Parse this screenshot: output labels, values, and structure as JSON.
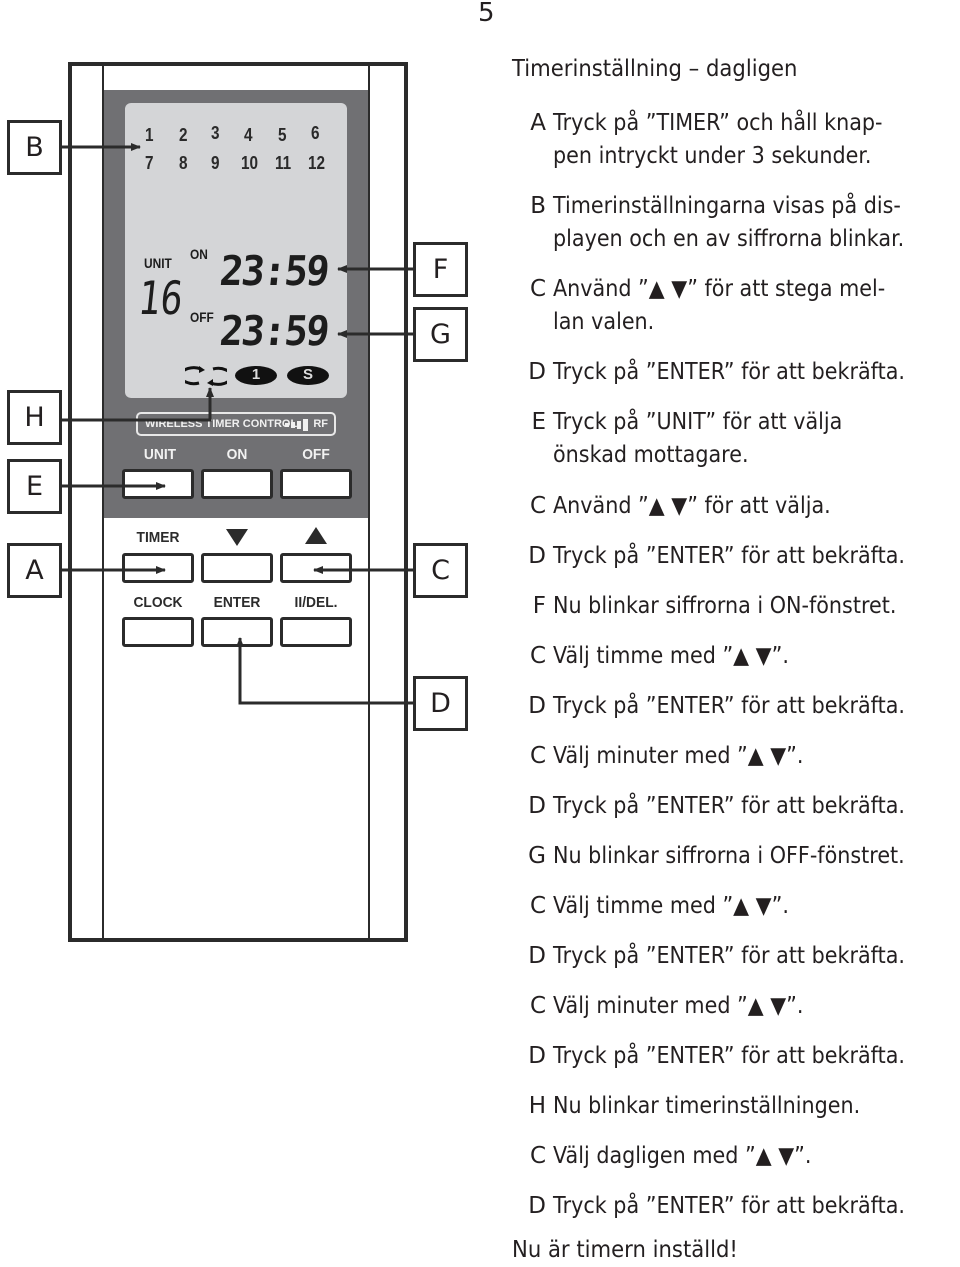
{
  "page_number": "5",
  "remote": {
    "lcd": {
      "channel_numbers_row1": [
        "1",
        "2",
        "3",
        "4",
        "5",
        "6"
      ],
      "channel_numbers_row2": [
        "7",
        "8",
        "9",
        "10",
        "11",
        "12"
      ],
      "unit_label": "UNIT",
      "unit_value": "16",
      "on_label": "ON",
      "on_time": "23:59",
      "off_label": "OFF",
      "off_time": "23:59",
      "icons": [
        {
          "name": "repeat-icon",
          "glyph": "⟲⟳"
        },
        {
          "name": "once-icon",
          "glyph": "1"
        },
        {
          "name": "special-icon",
          "glyph": "S"
        }
      ]
    },
    "brand": "WIRELESS TIMER CONTROL",
    "rf_label": "RF",
    "buttons": {
      "row1_labels": [
        "UNIT",
        "ON",
        "OFF"
      ],
      "row2_labels": [
        "TIMER",
        "▼",
        "▲"
      ],
      "row3_labels": [
        "CLOCK",
        "ENTER",
        "II/DEL."
      ]
    }
  },
  "callouts": {
    "left": [
      "B",
      "H",
      "E",
      "A"
    ],
    "right": [
      "F",
      "G",
      "C",
      "D"
    ]
  },
  "instructions": {
    "heading": "Timerinställning – dagligen",
    "steps": [
      {
        "letter": "A",
        "lines": [
          "Tryck på ”TIMER” och håll knap-",
          "pen intryckt under 3 sekunder."
        ]
      },
      {
        "letter": "B",
        "lines": [
          "Timerinställningarna visas på dis-",
          "playen och en av siffrorna blinkar."
        ]
      },
      {
        "letter": "C",
        "lines": [
          "Använd ”▲ ▼” för att stega mel-",
          "lan valen."
        ]
      },
      {
        "letter": "D",
        "lines": [
          "Tryck på ”ENTER” för att bekräfta."
        ]
      },
      {
        "letter": "E",
        "lines": [
          "Tryck på ”UNIT” för att välja",
          "önskad mottagare."
        ]
      },
      {
        "letter": "C",
        "lines": [
          "Använd ”▲ ▼” för att välja."
        ]
      },
      {
        "letter": "D",
        "lines": [
          "Tryck på ”ENTER” för att bekräfta."
        ]
      },
      {
        "letter": "F",
        "lines": [
          "Nu blinkar siffrorna i ON-fönstret."
        ]
      },
      {
        "letter": "C",
        "lines": [
          "Välj timme med ”▲ ▼”."
        ]
      },
      {
        "letter": "D",
        "lines": [
          "Tryck på ”ENTER” för att bekräfta."
        ]
      },
      {
        "letter": "C",
        "lines": [
          "Välj minuter med ”▲ ▼”."
        ]
      },
      {
        "letter": "D",
        "lines": [
          "Tryck på ”ENTER” för att bekräfta."
        ]
      },
      {
        "letter": "G",
        "lines": [
          "Nu blinkar siffrorna i OFF-fönstret."
        ]
      },
      {
        "letter": "C",
        "lines": [
          "Välj timme med  ”▲ ▼”."
        ]
      },
      {
        "letter": "D",
        "lines": [
          "Tryck på ”ENTER” för att bekräfta."
        ]
      },
      {
        "letter": "C",
        "lines": [
          "Välj minuter med ”▲ ▼”."
        ]
      },
      {
        "letter": "D",
        "lines": [
          "Tryck på ”ENTER” för att bekräfta."
        ]
      },
      {
        "letter": "H",
        "lines": [
          "Nu blinkar timerinställningen."
        ]
      },
      {
        "letter": "C",
        "lines": [
          "Välj dagligen med  ”▲ ▼”."
        ]
      },
      {
        "letter": "D",
        "lines": [
          "Tryck på ”ENTER” för att bekräfta."
        ]
      }
    ],
    "footer": "Nu är timern inställd!"
  }
}
